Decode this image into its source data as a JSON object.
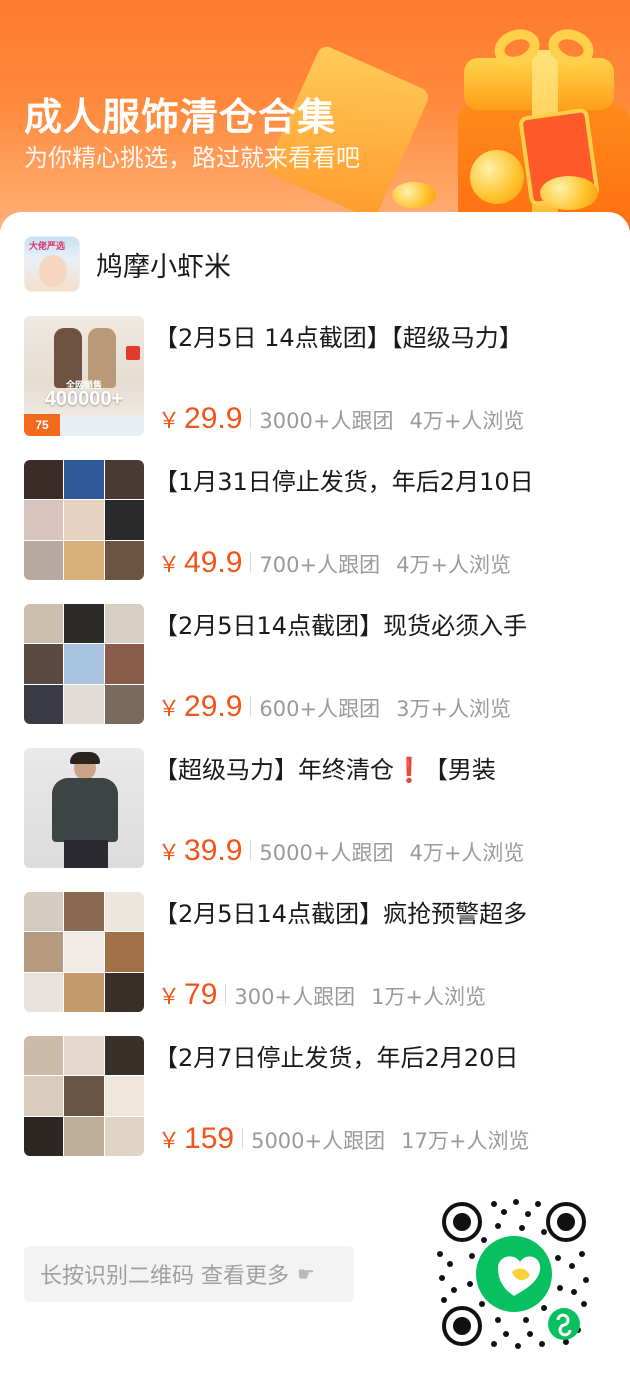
{
  "banner": {
    "title": "成人服饰清仓合集",
    "subtitle": "为你精心挑选，路过就来看看吧"
  },
  "shop": {
    "name": "鸠摩小虾米",
    "avatar_tag": "大佬严选"
  },
  "colors": {
    "accent": "#f2541b",
    "banner_top": "#ff7a2e",
    "muted": "#9a9a9a",
    "qr_green": "#07c160"
  },
  "products": [
    {
      "title": "【2月5日 14点截团】【超级马力】",
      "currency": "￥",
      "price": "29.9",
      "joined": "3000+人跟团",
      "views": "4万+人浏览"
    },
    {
      "title": "【1月31日停止发货，年后2月10日",
      "currency": "￥",
      "price": "49.9",
      "joined": "700+人跟团",
      "views": "4万+人浏览"
    },
    {
      "title": "【2月5日14点截团】现货必须入手",
      "currency": "￥",
      "price": "29.9",
      "joined": "600+人跟团",
      "views": "3万+人浏览"
    },
    {
      "title": "【超级马力】年终清仓❗【男装",
      "currency": "￥",
      "price": "39.9",
      "joined": "5000+人跟团",
      "views": "4万+人浏览"
    },
    {
      "title": "【2月5日14点截团】疯抢预警超多",
      "currency": "￥",
      "price": "79",
      "joined": "300+人跟团",
      "views": "1万+人浏览"
    },
    {
      "title": "【2月7日停止发货，年后2月20日",
      "currency": "￥",
      "price": "159",
      "joined": "5000+人跟团",
      "views": "17万+人浏览"
    }
  ],
  "product1_badge": {
    "line1": "全网销售",
    "line2": "400000+",
    "small": "75"
  },
  "footer": {
    "press_label": "长按识别二维码 查看更多",
    "arrow_icon": "hand-pointer-icon"
  }
}
